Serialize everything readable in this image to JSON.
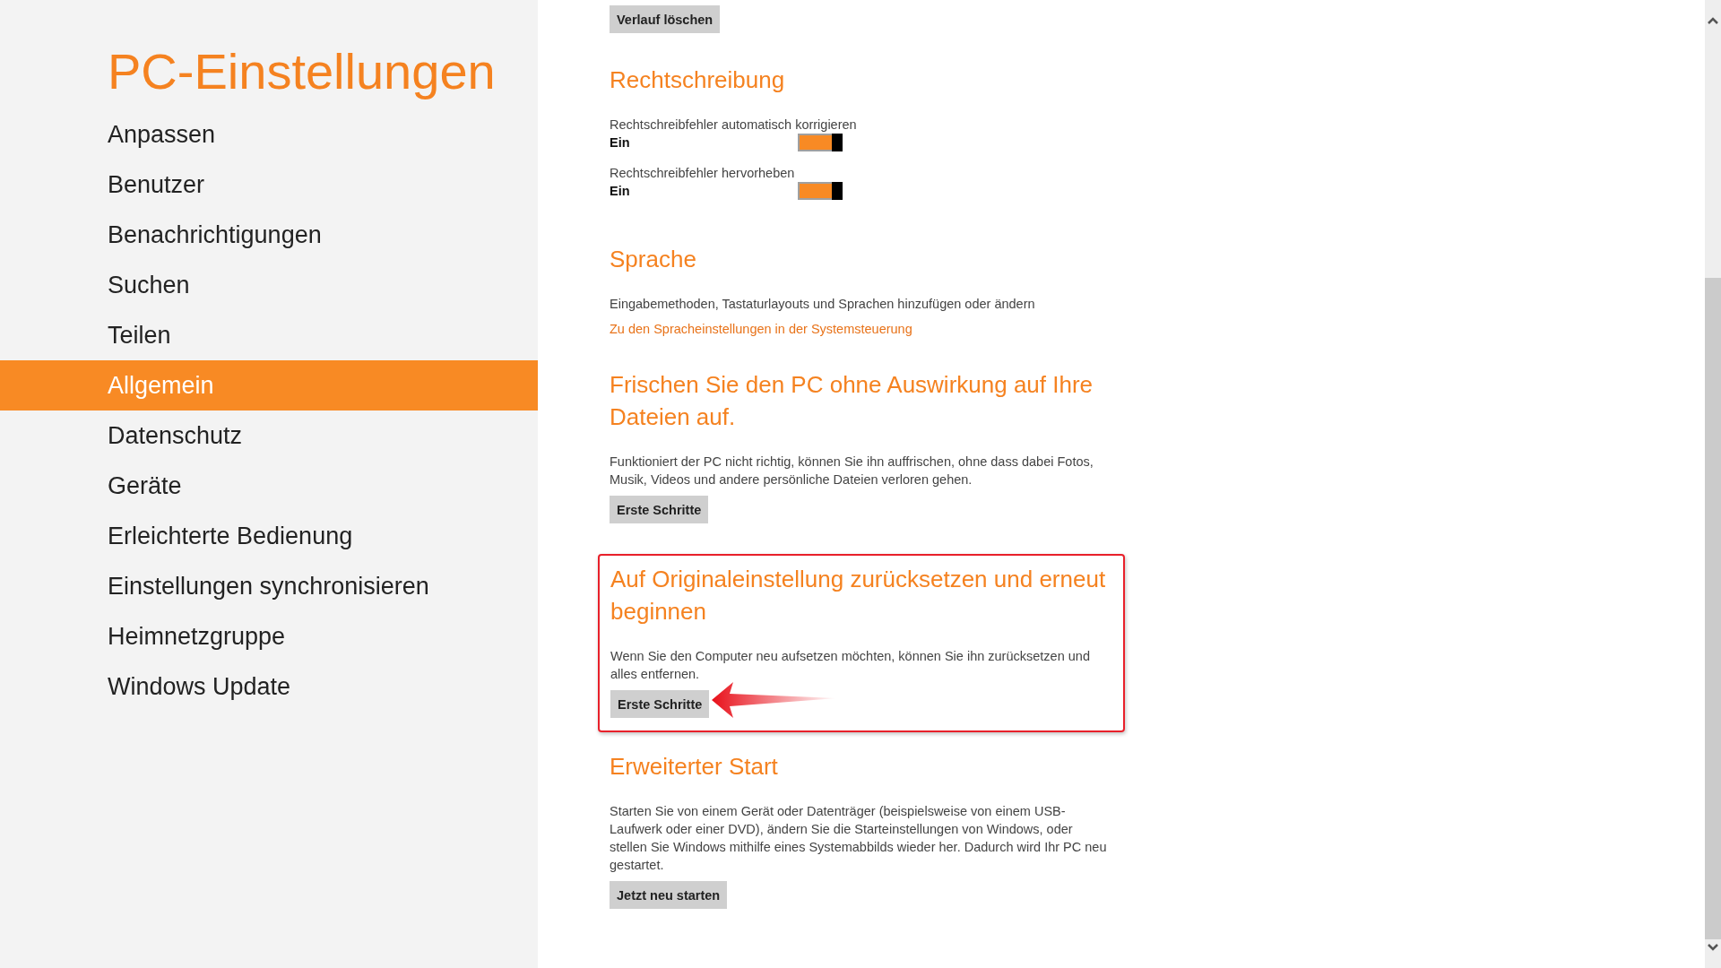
{
  "sidebar": {
    "title": "PC-Einstellungen",
    "items": [
      {
        "label": "Anpassen",
        "selected": false
      },
      {
        "label": "Benutzer",
        "selected": false
      },
      {
        "label": "Benachrichtigungen",
        "selected": false
      },
      {
        "label": "Suchen",
        "selected": false
      },
      {
        "label": "Teilen",
        "selected": false
      },
      {
        "label": "Allgemein",
        "selected": true
      },
      {
        "label": "Datenschutz",
        "selected": false
      },
      {
        "label": "Geräte",
        "selected": false
      },
      {
        "label": "Erleichterte Bedienung",
        "selected": false
      },
      {
        "label": "Einstellungen synchronisieren",
        "selected": false
      },
      {
        "label": "Heimnetzgruppe",
        "selected": false
      },
      {
        "label": "Windows Update",
        "selected": false
      }
    ]
  },
  "sections": [
    {
      "kind": "action",
      "button": "Verlauf löschen"
    },
    {
      "kind": "toggles",
      "title": "Rechtschreibung",
      "toggles": [
        {
          "label": "Rechtschreibfehler automatisch korrigieren",
          "state": "Ein",
          "on": true
        },
        {
          "label": "Rechtschreibfehler hervorheben",
          "state": "Ein",
          "on": true
        }
      ]
    },
    {
      "kind": "link",
      "title": "Sprache",
      "text": "Eingabemethoden, Tastaturlayouts und Sprachen hinzufügen oder ändern",
      "link": "Zu den Spracheinstellungen in der Systemsteuerung"
    },
    {
      "kind": "action",
      "title": "Frischen Sie den PC ohne Auswirkung auf Ihre Dateien auf.",
      "text": "Funktioniert der PC nicht richtig, können Sie ihn auffrischen, ohne dass dabei Fotos, Musik, Videos und andere persönliche Dateien verloren gehen.",
      "button": "Erste Schritte",
      "highlighted": false
    },
    {
      "kind": "action",
      "title": "Auf Originaleinstellung zurücksetzen und erneut beginnen",
      "text": "Wenn Sie den Computer neu aufsetzen möchten, können Sie ihn zurücksetzen und alles entfernen.",
      "button": "Erste Schritte",
      "highlighted": true
    },
    {
      "kind": "action",
      "title": "Erweiterter Start",
      "text": "Starten Sie von einem Gerät oder Datenträger (beispielsweise von einem USB-Laufwerk oder einer DVD), ändern Sie die Starteinstellungen von Windows, oder stellen Sie Windows mithilfe eines Systemabbilds wieder her. Dadurch wird Ihr PC neu gestartet.",
      "button": "Jetzt neu starten",
      "highlighted": false
    }
  ]
}
